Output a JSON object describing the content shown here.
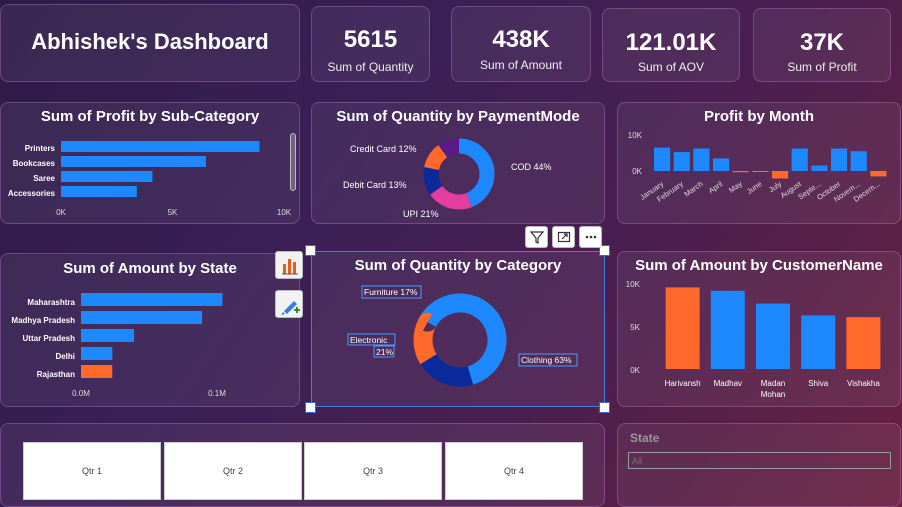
{
  "header": {
    "title": "Abhishek's Dashboard"
  },
  "kpis": [
    {
      "value": "5615",
      "label": "Sum of Quantity"
    },
    {
      "value": "438K",
      "label": "Sum of Amount"
    },
    {
      "value": "121.01K",
      "label": "Sum of AOV"
    },
    {
      "value": "37K",
      "label": "Sum of Profit"
    }
  ],
  "colors": {
    "blue": "#1e88ff",
    "orange": "#ff6a2b",
    "pink": "#e33da0",
    "purple": "#5a1a8a",
    "navy": "#0a2a9a"
  },
  "visuals": {
    "profit_subcat": {
      "title": "Sum of Profit by Sub-Category"
    },
    "qty_payment": {
      "title": "Sum of Quantity by PaymentMode"
    },
    "profit_month": {
      "title": "Profit by Month"
    },
    "amount_state": {
      "title": "Sum of Amount by State"
    },
    "qty_category": {
      "title": "Sum of Quantity by Category"
    },
    "amount_customer": {
      "title": "Sum of Amount by CustomerName"
    }
  },
  "chart_data": [
    {
      "id": "profit_subcat",
      "type": "bar",
      "orientation": "horizontal",
      "categories": [
        "Printers",
        "Bookcases",
        "Saree",
        "Accessories"
      ],
      "values": [
        8900,
        6500,
        4100,
        3400
      ],
      "xticks": [
        "0K",
        "5K",
        "10K"
      ],
      "xlim": [
        0,
        10000
      ]
    },
    {
      "id": "qty_payment",
      "type": "pie",
      "donut": true,
      "slices": [
        {
          "label": "COD 44%",
          "value": 44,
          "color": "#1e88ff"
        },
        {
          "label": "UPI 21%",
          "value": 21,
          "color": "#e33da0"
        },
        {
          "label": "Debit Card 13%",
          "value": 13,
          "color": "#0a2a9a"
        },
        {
          "label": "Credit Card 12%",
          "value": 12,
          "color": "#ff6a2b"
        },
        {
          "label": "",
          "value": 10,
          "color": "#5a1a8a"
        }
      ]
    },
    {
      "id": "profit_month",
      "type": "bar",
      "categories": [
        "January",
        "February",
        "March",
        "April",
        "May",
        "June",
        "July",
        "August",
        "Septe...",
        "October",
        "Novem...",
        "Decem..."
      ],
      "values": [
        7800,
        6300,
        7500,
        4200,
        -400,
        -300,
        -2500,
        7500,
        1800,
        7500,
        6600,
        -1800
      ],
      "yticks": [
        "10K",
        "0K"
      ],
      "ylim": [
        -3500,
        11000
      ],
      "colors": [
        "#1e88ff",
        "#1e88ff",
        "#1e88ff",
        "#1e88ff",
        "#ff6a2b",
        "#ff6a2b",
        "#ff6a2b",
        "#1e88ff",
        "#1e88ff",
        "#1e88ff",
        "#1e88ff",
        "#ff6a2b"
      ]
    },
    {
      "id": "amount_state",
      "type": "bar",
      "orientation": "horizontal",
      "categories": [
        "Maharashtra",
        "Madhya Pradesh",
        "Uttar Pradesh",
        "Delhi",
        "Rajasthan"
      ],
      "values": [
        104000,
        89000,
        39000,
        23000,
        23000
      ],
      "colors": [
        "#1e88ff",
        "#1e88ff",
        "#1e88ff",
        "#1e88ff",
        "#ff6a2b"
      ],
      "xticks": [
        "0.0M",
        "0.1M"
      ],
      "xlim": [
        0,
        100000
      ]
    },
    {
      "id": "qty_category",
      "type": "pie",
      "donut": true,
      "slices": [
        {
          "label": "Clothing 63%",
          "value": 63,
          "color": "#1e88ff"
        },
        {
          "label": "Electronics 21%",
          "label_lines": [
            "Electronic",
            "21%"
          ],
          "value": 21,
          "color": "#0a2a9a"
        },
        {
          "label": "Furniture 17%",
          "value": 17,
          "color": "#ff6a2b"
        }
      ]
    },
    {
      "id": "amount_customer",
      "type": "bar",
      "categories": [
        "Harivansh",
        "Madhav",
        "Madan Mohan",
        "Shiva",
        "Vishakha"
      ],
      "category_lines": [
        [
          "Harivansh"
        ],
        [
          "Madhav"
        ],
        [
          "Madan",
          "Mohan"
        ],
        [
          "Shiva"
        ],
        [
          "Vishakha"
        ]
      ],
      "values": [
        9600,
        9200,
        7700,
        6300,
        6100
      ],
      "colors": [
        "#ff6a2b",
        "#1e88ff",
        "#1e88ff",
        "#1e88ff",
        "#ff6a2b"
      ],
      "yticks": [
        "10K",
        "5K",
        "0K"
      ],
      "ylim": [
        0,
        10000
      ]
    }
  ],
  "slicers": {
    "quarters": [
      "Qtr 1",
      "Qtr 2",
      "Qtr 3",
      "Qtr 4"
    ],
    "state": {
      "title": "State",
      "placeholder": "All"
    }
  }
}
